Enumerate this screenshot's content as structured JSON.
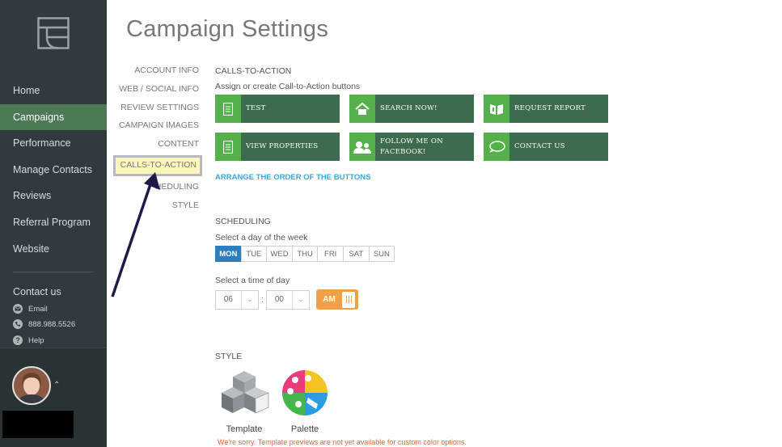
{
  "sidebar": {
    "nav": [
      "Home",
      "Campaigns",
      "Performance",
      "Manage Contacts",
      "Reviews",
      "Referral Program",
      "Website"
    ],
    "contact": {
      "title": "Contact us",
      "email": "Email",
      "phone": "888.988.5526",
      "help": "Help"
    }
  },
  "page": {
    "title": "Campaign Settings"
  },
  "subnav": [
    "ACCOUNT INFO",
    "WEB / SOCIAL INFO",
    "REVIEW SETTINGS",
    "CAMPAIGN IMAGES",
    "CONTENT",
    "CALLS-TO-ACTION",
    "SCHEDULING",
    "STYLE"
  ],
  "subnav_scheduling_visible": "HEDULING",
  "cta": {
    "title": "CALLS-TO-ACTION",
    "subtitle": "Assign or create Call-to-Action buttons",
    "buttons": [
      {
        "label": "TEST",
        "icon": "document-icon"
      },
      {
        "label": "SEARCH NOW!",
        "icon": "house-icon"
      },
      {
        "label": "REQUEST REPORT",
        "icon": "report-icon"
      },
      {
        "label": "VIEW PROPERTIES",
        "icon": "document-icon"
      },
      {
        "label_line1": "FOLLOW ME ON",
        "label_line2": "FACEBOOK!",
        "icon": "people-icon"
      },
      {
        "label": "CONTACT US",
        "icon": "chat-icon"
      }
    ],
    "arrange_link": "ARRANGE THE ORDER OF THE BUTTONS"
  },
  "scheduling": {
    "title": "SCHEDULING",
    "day_label": "Select a day of the week",
    "days": [
      "MON",
      "TUE",
      "WED",
      "THU",
      "FRI",
      "SAT",
      "SUN"
    ],
    "selected_day": "MON",
    "time_label": "Select a time of day",
    "hour": "06",
    "minute": "00",
    "colon": ":",
    "ampm": "AM"
  },
  "style": {
    "title": "STYLE",
    "template_label": "Template",
    "palette_label": "Palette",
    "warning": "We're sorry. Template previews are not yet available for custom color options."
  },
  "colors": {
    "sidebar_bg": "#2f3b3f",
    "active_green": "#4b7a55",
    "cta_dark": "#3d6b4d",
    "cta_light": "#53b04b",
    "selected_day": "#2b7fc0",
    "ampm": "#f0a04b",
    "link": "#3aa8d8",
    "warning": "#e4643b",
    "highlight": "#fcf7b8"
  }
}
